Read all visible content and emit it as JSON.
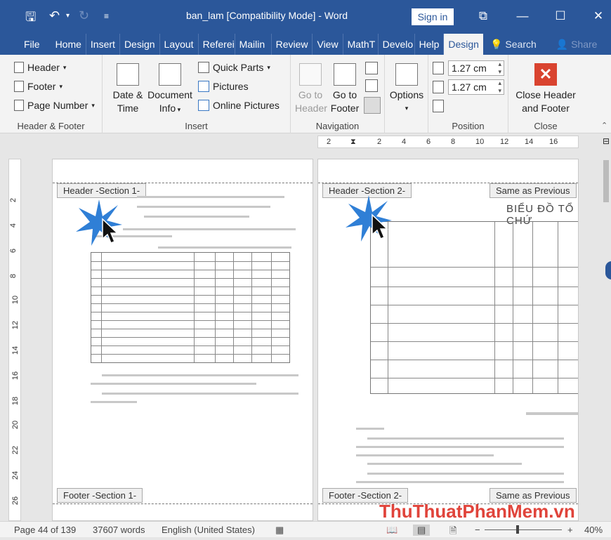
{
  "titlebar": {
    "title": "ban_lam [Compatibility Mode]  -  Word",
    "signin": "Sign in",
    "save_icon": "save-icon",
    "undo_icon": "undo-icon",
    "redo_icon": "redo-icon",
    "customize_icon": "customize-icon"
  },
  "tabs": [
    "File",
    "Home",
    "Insert",
    "Design",
    "Layout",
    "Referei",
    "Mailin",
    "Review",
    "View",
    "MathT",
    "Develo",
    "Help",
    "Design"
  ],
  "search_label": "Search",
  "share_label": "Share",
  "ribbon": {
    "header_footer": {
      "header": "Header",
      "footer": "Footer",
      "page_number": "Page Number",
      "label": "Header & Footer"
    },
    "insert": {
      "date_time_1": "Date &",
      "date_time_2": "Time",
      "doc_info_1": "Document",
      "doc_info_2": "Info",
      "quick_parts": "Quick Parts",
      "pictures": "Pictures",
      "online_pictures": "Online Pictures",
      "label": "Insert"
    },
    "navigation": {
      "goto_header_1": "Go to",
      "goto_header_2": "Header",
      "goto_footer_1": "Go to",
      "goto_footer_2": "Footer",
      "label": "Navigation"
    },
    "options": {
      "options": "Options"
    },
    "position": {
      "header_pos": "1.27 cm",
      "footer_pos": "1.27 cm",
      "label": "Position"
    },
    "close": {
      "close_1": "Close Header",
      "close_2": "and Footer",
      "label": "Close"
    }
  },
  "ruler_marks": [
    "2",
    "2",
    "4",
    "6",
    "8",
    "10",
    "12",
    "14",
    "16"
  ],
  "vruler_marks": [
    "2",
    "4",
    "6",
    "8",
    "10",
    "12",
    "14",
    "16",
    "18",
    "20",
    "22",
    "24",
    "26"
  ],
  "page1": {
    "header_tag": "Header -Section 1-",
    "footer_tag": "Footer -Section 1-"
  },
  "page2": {
    "header_tag": "Header -Section 2-",
    "same_as_previous_top": "Same as Previous",
    "footer_tag": "Footer -Section 2-",
    "same_as_previous_bottom": "Same as Previous",
    "big_title": "BIỂU ĐỒ TỔ CHỨ"
  },
  "status": {
    "page": "Page 44 of 139",
    "words": "37607 words",
    "language": "English (United States)",
    "zoom": "40%"
  },
  "watermark": "ThuThuatPhanMem.vn"
}
